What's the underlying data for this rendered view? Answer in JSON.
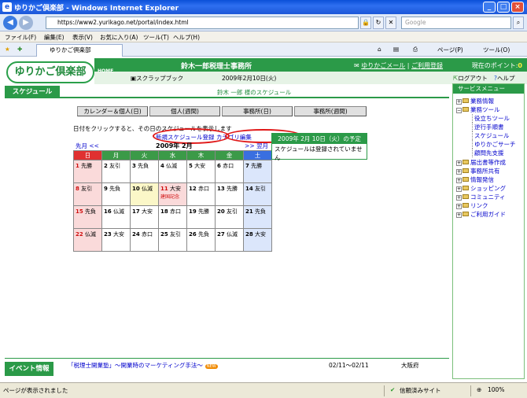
{
  "window": {
    "title": "ゆりかご倶楽部 - Windows Internet Explorer",
    "icon_letter": "e"
  },
  "addressbar": {
    "url": "https://www2.yurikago.net/portal/index.html",
    "search_placeholder": "Google"
  },
  "menubar": {
    "items": [
      "ファイル(F)",
      "編集(E)",
      "表示(V)",
      "お気に入り(A)",
      "ツール(T)",
      "ヘルプ(H)"
    ]
  },
  "tabbar": {
    "tab_label": "ゆりかご倶楽部",
    "page_label": "ページ(P)",
    "tools_label": "ツール(O)"
  },
  "header": {
    "logo_text": "ゆりかご倶楽部",
    "home_label": "HOME",
    "office_name": "鈴木一郎税理士事務所",
    "mail_link": "ゆりかごメール",
    "register_link": "ご利用登録",
    "points_label": "現在のポイント:",
    "points_value": "0",
    "scrapbook_label": "スクラップブック",
    "date": "2009年2月10日(火)",
    "logout_label": "ログアウト",
    "help_label": "ヘルプ"
  },
  "section": {
    "title": "スケジュール",
    "user_schedule": "鈴木 一郎 様のスケジュール"
  },
  "view_buttons": [
    "カレンダー＆個人(日)",
    "個人(週間)",
    "事務所(日)",
    "事務所(週間)"
  ],
  "instruction": "日付をクリックすると、その日のスケジュールを表示します",
  "links": {
    "new_schedule": "新規スケジュール登録",
    "category_edit": "カテゴリ編集"
  },
  "calendar": {
    "prev_label": "先月 <<",
    "month_label": "2009年 2月",
    "next_label": ">> 翌月",
    "weekdays": [
      "日",
      "月",
      "火",
      "水",
      "木",
      "金",
      "土"
    ],
    "weeks": [
      [
        {
          "d": "1",
          "r": "先勝"
        },
        {
          "d": "2",
          "r": "友引"
        },
        {
          "d": "3",
          "r": "先負"
        },
        {
          "d": "4",
          "r": "仏滅"
        },
        {
          "d": "5",
          "r": "大安"
        },
        {
          "d": "6",
          "r": "赤口"
        },
        {
          "d": "7",
          "r": "先勝"
        }
      ],
      [
        {
          "d": "8",
          "r": "友引"
        },
        {
          "d": "9",
          "r": "先負"
        },
        {
          "d": "10",
          "r": "仏滅"
        },
        {
          "d": "11",
          "r": "大安",
          "memo": "建国記念"
        },
        {
          "d": "12",
          "r": "赤口"
        },
        {
          "d": "13",
          "r": "先勝"
        },
        {
          "d": "14",
          "r": "友引"
        }
      ],
      [
        {
          "d": "15",
          "r": "先負"
        },
        {
          "d": "16",
          "r": "仏滅"
        },
        {
          "d": "17",
          "r": "大安"
        },
        {
          "d": "18",
          "r": "赤口"
        },
        {
          "d": "19",
          "r": "先勝"
        },
        {
          "d": "20",
          "r": "友引"
        },
        {
          "d": "21",
          "r": "先負"
        }
      ],
      [
        {
          "d": "22",
          "r": "仏滅"
        },
        {
          "d": "23",
          "r": "大安"
        },
        {
          "d": "24",
          "r": "赤口"
        },
        {
          "d": "25",
          "r": "友引"
        },
        {
          "d": "26",
          "r": "先負"
        },
        {
          "d": "27",
          "r": "仏滅"
        },
        {
          "d": "28",
          "r": "大安"
        }
      ]
    ]
  },
  "schedule_panel": {
    "header": "2009年 2月 10日（火）の予定",
    "body": "スケジュールは登録されていません"
  },
  "side_menu": {
    "title": "サービスメニュー",
    "items": [
      "業務情報",
      "業務ツール",
      "届出書等作成",
      "事務所共有",
      "情報発信",
      "ショッピング",
      "コミュニティ",
      "リンク",
      "ご利用ガイド"
    ],
    "sub_items": [
      "役立ちツール",
      "逆行手順書",
      "スケジュール",
      "ゆりかごサーチ",
      "顧問先支援"
    ]
  },
  "event": {
    "title": "イベント情報",
    "link": "「税理士開業塾」～開業時のマーケティング手法～",
    "new_badge": "NEW",
    "date": "02/11～02/11",
    "place": "大阪府"
  },
  "statusbar": {
    "left": "ページが表示されました",
    "trusted": "信頼済みサイト",
    "zoom": "100%"
  }
}
